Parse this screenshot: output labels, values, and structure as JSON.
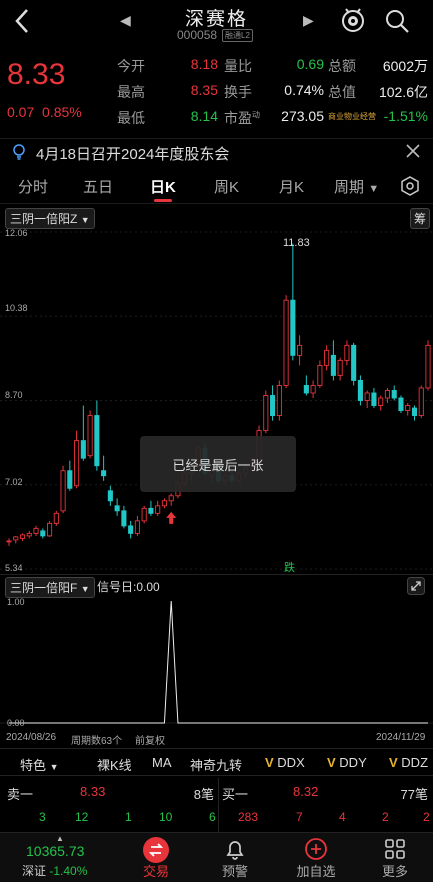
{
  "header": {
    "back_icon": "chevron-left-icon",
    "prev_icon": "triangle-left-icon",
    "next_icon": "triangle-right-icon",
    "stock_name": "深赛格",
    "stock_code": "000058",
    "code_tag": "融通L2",
    "robot_icon": "assistant-icon",
    "search_icon": "search-icon"
  },
  "quote": {
    "price": "8.33",
    "change": "0.07",
    "change_pct": "0.85%",
    "rows": [
      {
        "l1": "今开",
        "v1": "8.18",
        "l2": "量比",
        "v2": "0.69",
        "l3": "总额",
        "v3": "6002万"
      },
      {
        "l1": "最高",
        "v1": "8.35",
        "l2": "换手",
        "v2": "0.74%",
        "l3": "总值",
        "v3": "102.6亿"
      },
      {
        "l1": "最低",
        "v1": "8.14",
        "l2": "市盈",
        "l2sup": "动",
        "v2": "273.05",
        "l3": "商业物业经营",
        "v3": "-1.51%"
      }
    ]
  },
  "notice": {
    "icon": "lightbulb-icon",
    "text": "4月18日召开2024年度股东会",
    "close_icon": "close-icon"
  },
  "tabs": {
    "items": [
      "分时",
      "五日",
      "日K",
      "周K",
      "月K",
      "周期"
    ],
    "active": "日K",
    "settings_icon": "gear-icon"
  },
  "chart": {
    "indicator_top": "三阴一倍阳Z",
    "chips_label": "筹",
    "y_ticks": [
      "12.06",
      "10.38",
      "8.70",
      "7.02",
      "5.34"
    ],
    "high_label": "11.83",
    "fall_label": "跌",
    "toast": "已经是最后一张",
    "indicator_bottom": "三阴一倍阳F",
    "signal_text": "信号日:0.00",
    "sub_ticks": [
      "1.00",
      "0.00"
    ],
    "date_start": "2024/08/26",
    "period_count": "周期数63个",
    "adjust": "前复权",
    "date_end": "2024/11/29",
    "expand_icon": "expand-icon"
  },
  "chart_data": {
    "type": "candlestick",
    "candles": [
      [
        5.9,
        5.95,
        5.8,
        5.9
      ],
      [
        5.92,
        6.0,
        5.85,
        5.98
      ],
      [
        5.95,
        6.05,
        5.9,
        6.02
      ],
      [
        6.0,
        6.1,
        5.95,
        6.05
      ],
      [
        6.05,
        6.2,
        6.0,
        6.15
      ],
      [
        6.1,
        6.15,
        5.95,
        6.0
      ],
      [
        6.0,
        6.3,
        5.98,
        6.25
      ],
      [
        6.25,
        6.5,
        6.2,
        6.45
      ],
      [
        6.5,
        7.4,
        6.45,
        7.3
      ],
      [
        7.3,
        7.5,
        6.9,
        6.95
      ],
      [
        7.0,
        8.1,
        6.95,
        7.9
      ],
      [
        7.9,
        8.6,
        7.5,
        7.55
      ],
      [
        7.6,
        8.5,
        7.55,
        8.4
      ],
      [
        8.4,
        8.7,
        7.3,
        7.4
      ],
      [
        7.3,
        7.6,
        7.1,
        7.2
      ],
      [
        6.9,
        7.0,
        6.6,
        6.7
      ],
      [
        6.6,
        6.75,
        6.4,
        6.5
      ],
      [
        6.5,
        6.6,
        6.15,
        6.2
      ],
      [
        6.2,
        6.3,
        5.95,
        6.05
      ],
      [
        6.05,
        6.4,
        6.0,
        6.3
      ],
      [
        6.3,
        6.6,
        6.25,
        6.55
      ],
      [
        6.55,
        6.7,
        6.4,
        6.45
      ],
      [
        6.45,
        6.7,
        6.4,
        6.6
      ],
      [
        6.6,
        6.75,
        6.55,
        6.7
      ],
      [
        6.7,
        6.85,
        6.6,
        6.8
      ],
      [
        6.8,
        7.1,
        6.75,
        7.05
      ],
      [
        7.05,
        7.3,
        7.0,
        7.25
      ],
      [
        7.25,
        7.45,
        7.1,
        7.4
      ],
      [
        7.4,
        7.8,
        7.35,
        7.75
      ],
      [
        7.75,
        7.85,
        7.2,
        7.25
      ],
      [
        7.2,
        7.35,
        7.05,
        7.3
      ],
      [
        7.3,
        7.35,
        7.05,
        7.1
      ],
      [
        7.1,
        7.25,
        7.0,
        7.2
      ],
      [
        7.2,
        7.3,
        7.05,
        7.1
      ],
      [
        7.1,
        7.3,
        7.05,
        7.25
      ],
      [
        7.25,
        7.4,
        7.15,
        7.35
      ],
      [
        7.35,
        7.55,
        7.25,
        7.45
      ],
      [
        7.45,
        8.2,
        7.4,
        8.1
      ],
      [
        8.1,
        8.9,
        8.05,
        8.8
      ],
      [
        8.8,
        9.0,
        8.3,
        8.4
      ],
      [
        8.4,
        9.1,
        8.3,
        9.0
      ],
      [
        9.0,
        10.8,
        8.95,
        10.7
      ],
      [
        10.7,
        11.83,
        9.5,
        9.6
      ],
      [
        9.6,
        10.0,
        9.4,
        9.8
      ],
      [
        9.0,
        9.2,
        8.8,
        8.85
      ],
      [
        8.85,
        9.1,
        8.75,
        9.0
      ],
      [
        9.0,
        9.5,
        8.95,
        9.4
      ],
      [
        9.4,
        9.8,
        9.3,
        9.7
      ],
      [
        9.6,
        9.9,
        9.1,
        9.2
      ],
      [
        9.2,
        9.55,
        9.1,
        9.5
      ],
      [
        9.5,
        9.9,
        9.4,
        9.8
      ],
      [
        9.8,
        9.85,
        9.0,
        9.1
      ],
      [
        9.1,
        9.2,
        8.6,
        8.7
      ],
      [
        8.7,
        8.9,
        8.55,
        8.85
      ],
      [
        8.85,
        8.95,
        8.55,
        8.6
      ],
      [
        8.6,
        8.8,
        8.5,
        8.75
      ],
      [
        8.75,
        8.95,
        8.65,
        8.9
      ],
      [
        8.9,
        9.0,
        8.7,
        8.75
      ],
      [
        8.75,
        8.8,
        8.45,
        8.5
      ],
      [
        8.5,
        8.65,
        8.4,
        8.6
      ],
      [
        8.55,
        8.6,
        8.3,
        8.4
      ],
      [
        8.4,
        9.0,
        8.35,
        8.95
      ],
      [
        8.95,
        9.9,
        8.9,
        9.8
      ]
    ],
    "ylim": [
      5.34,
      12.06
    ],
    "signal_index": 24,
    "sub_ylim": [
      0,
      1
    ]
  },
  "features": {
    "items": [
      "特色",
      "裸K线",
      "MA",
      "神奇九转",
      "DDX",
      "DDY",
      "DDZ"
    ]
  },
  "orderbook": {
    "sell_label": "卖一",
    "sell_price": "8.33",
    "sell_qty": "8笔",
    "buy_label": "买一",
    "buy_price": "8.32",
    "buy_qty": "77笔",
    "sell_nums": [
      "3",
      "12",
      "1",
      "10",
      "6"
    ],
    "buy_nums": [
      "283",
      "7",
      "4",
      "2",
      "2"
    ]
  },
  "bottom": {
    "index_value": "10365.73",
    "index_name": "深证",
    "index_pct": "-1.40%",
    "nav": [
      {
        "label": "交易",
        "icon": "trade-icon"
      },
      {
        "label": "预警",
        "icon": "bell-icon"
      },
      {
        "label": "加自选",
        "icon": "add-circle-icon"
      },
      {
        "label": "更多",
        "icon": "grid-icon"
      }
    ]
  }
}
